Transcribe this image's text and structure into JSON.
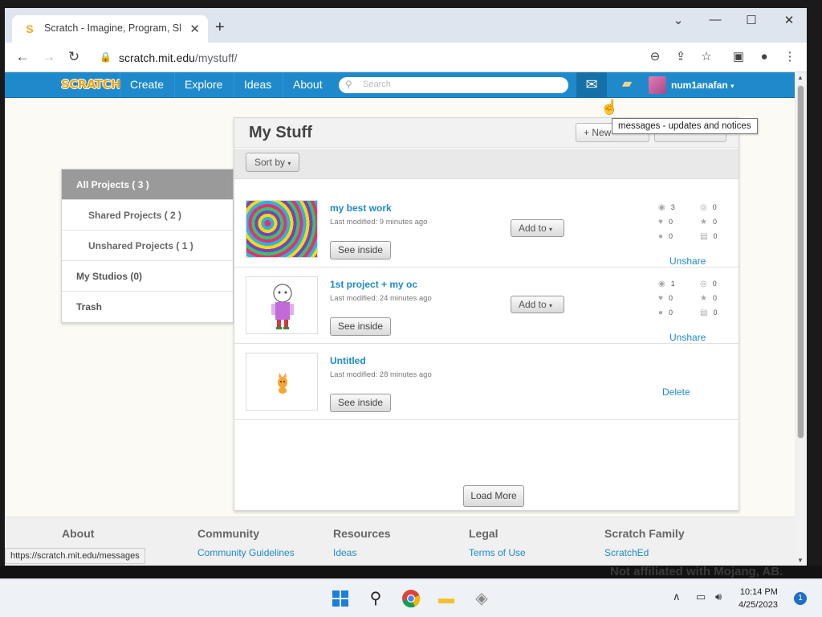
{
  "browser": {
    "tab_title": "Scratch - Imagine, Program, Share",
    "tab_favicon": "S",
    "new_tab": "+",
    "url_host": "scratch.mit.edu",
    "url_path": "/mystuff/",
    "window_controls": [
      "⌄",
      "—",
      "☐",
      "✕"
    ]
  },
  "scratch_nav": {
    "logo": "SCRATCH",
    "links": [
      "Create",
      "Explore",
      "Ideas",
      "About"
    ],
    "search_placeholder": "Search",
    "username": "num1anafan",
    "dropdown_caret": "▾"
  },
  "tooltip": "messages - updates and notices",
  "sidebar": {
    "items": [
      {
        "label": "All Projects ( 3 )"
      },
      {
        "label": "Shared Projects ( 2 )"
      },
      {
        "label": "Unshared Projects ( 1 )"
      },
      {
        "label": "My Studios (0)"
      },
      {
        "label": "Trash"
      }
    ]
  },
  "main": {
    "title": "My Stuff",
    "new_button": "+ New",
    "sort_button": "Sort by",
    "see_inside": "See inside",
    "add_to": "Add to",
    "unshare": "Unshare",
    "delete": "Delete",
    "load_more": "Load More",
    "projects": [
      {
        "title": "my best work",
        "modified": "Last modified: 9 minutes ago",
        "views": "3",
        "loves": "0",
        "comments": "0",
        "remixes": "0",
        "favorites": "0",
        "studios": "0"
      },
      {
        "title": "1st project + my oc",
        "modified": "Last modified: 24 minutes ago",
        "views": "1",
        "loves": "0",
        "comments": "0",
        "remixes": "0",
        "favorites": "0",
        "studios": "0"
      },
      {
        "title": "Untitled",
        "modified": "Last modified: 28 minutes ago"
      }
    ]
  },
  "footer": {
    "columns": [
      {
        "heading": "About",
        "link": ""
      },
      {
        "heading": "Community",
        "link": "Community Guidelines"
      },
      {
        "heading": "Resources",
        "link": "Ideas"
      },
      {
        "heading": "Legal",
        "link": "Terms of Use"
      },
      {
        "heading": "Scratch Family",
        "link": "ScratchEd"
      }
    ]
  },
  "status_url": "https://scratch.mit.edu/messages",
  "background_text": "Not affiliated with Mojang, AB.",
  "taskbar": {
    "time": "10:14 PM",
    "date": "4/25/2023",
    "notification_count": "1"
  }
}
